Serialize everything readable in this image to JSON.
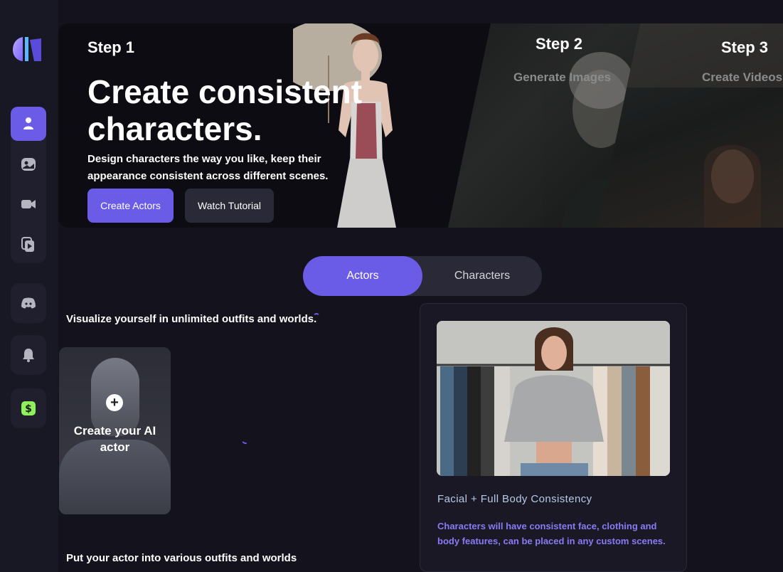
{
  "sidebar": {
    "items": [
      {
        "icon": "user-icon",
        "active": true
      },
      {
        "icon": "image-icon",
        "active": false
      },
      {
        "icon": "video-camera-icon",
        "active": false
      },
      {
        "icon": "video-copy-icon",
        "active": false
      }
    ],
    "discord_icon": "discord-icon",
    "bell_icon": "bell-icon",
    "dollar_icon": "dollar-icon"
  },
  "hero": {
    "step1": "Step 1",
    "step2": "Step 2",
    "step2_sub": "Generate Images",
    "step3": "Step 3",
    "step3_sub": "Create Videos",
    "title": "Create consistent characters.",
    "description": "Design characters the way you like, keep their appearance consistent across different scenes.",
    "primary_button": "Create Actors",
    "secondary_button": "Watch Tutorial"
  },
  "tabs": [
    {
      "label": "Actors",
      "active": true
    },
    {
      "label": "Characters",
      "active": false
    }
  ],
  "main": {
    "visualize_text": "Visualize yourself in unlimited outfits and worlds.",
    "create_actor_text": "Create your AI actor",
    "outfits_text": "Put your actor into various outfits and worlds"
  },
  "info_card": {
    "title": "Facial + Full Body Consistency",
    "description": "Characters will have consistent face, clothing and body features, can be placed in any custom scenes."
  },
  "colors": {
    "accent": "#6b5ce7",
    "background": "#13121d",
    "info_title": "#b8c9e8",
    "info_desc": "#8b7af5"
  }
}
